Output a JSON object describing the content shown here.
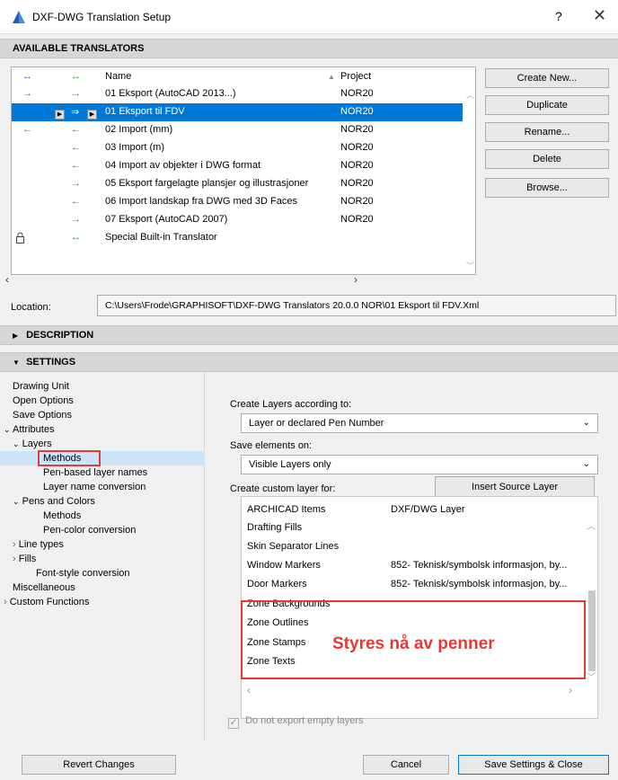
{
  "window": {
    "title": "DXF-DWG Translation Setup",
    "help_label": "?",
    "close_label": "✕"
  },
  "sections": {
    "available": "AVAILABLE TRANSLATORS",
    "description": "DESCRIPTION",
    "settings": "SETTINGS"
  },
  "translator_list": {
    "headers": {
      "name": "Name",
      "project": "Project"
    },
    "rows": [
      {
        "arrow_a": "→",
        "arrow_b": "→",
        "name": "01 Eksport (AutoCAD 2013...)",
        "project": "NOR20"
      },
      {
        "arrow_a": "",
        "arrow_b": "⇒",
        "name": "01 Eksport til FDV",
        "project": "NOR20"
      },
      {
        "arrow_a": "←",
        "arrow_b": "←",
        "name": "02 Import (mm)",
        "project": "NOR20"
      },
      {
        "arrow_a": "",
        "arrow_b": "←",
        "name": "03 Import (m)",
        "project": "NOR20"
      },
      {
        "arrow_a": "",
        "arrow_b": "←",
        "name": "04 Import av objekter i DWG format",
        "project": "NOR20"
      },
      {
        "arrow_a": "",
        "arrow_b": "→",
        "name": "05 Eksport fargelagte plansjer og illustrasjoner",
        "project": "NOR20"
      },
      {
        "arrow_a": "",
        "arrow_b": "←",
        "name": "06 Import landskap fra DWG med 3D Faces",
        "project": "NOR20"
      },
      {
        "arrow_a": "",
        "arrow_b": "→",
        "name": "07 Eksport (AutoCAD 2007)",
        "project": "NOR20"
      },
      {
        "arrow_a": "",
        "arrow_b": "↔",
        "name": "Special Built-in Translator",
        "project": ""
      }
    ]
  },
  "side_buttons": [
    "Create New...",
    "Duplicate",
    "Rename...",
    "Delete",
    "Browse..."
  ],
  "location": {
    "label": "Location:",
    "value": "C:\\Users\\Frode\\GRAPHISOFT\\DXF-DWG Translators 20.0.0 NOR\\01 Eksport til FDV.Xml"
  },
  "settings_tree": {
    "drawing_unit": "Drawing Unit",
    "open_options": "Open Options",
    "save_options": "Save Options",
    "attributes": "Attributes",
    "layers": "Layers",
    "methods": "Methods",
    "pen_based": "Pen-based layer names",
    "layer_name_conv": "Layer name conversion",
    "pens_colors": "Pens and Colors",
    "pens_methods": "Methods",
    "pen_color_conv": "Pen-color conversion",
    "line_types": "Line types",
    "fills": "Fills",
    "font_style": "Font-style conversion",
    "misc": "Miscellaneous",
    "custom_functions": "Custom Functions"
  },
  "panel": {
    "create_layers_label": "Create Layers according to:",
    "create_layers_value": "Layer or declared Pen Number",
    "save_elements_label": "Save elements on:",
    "save_elements_value": "Visible Layers only",
    "custom_layer_label": "Create custom layer for:",
    "insert_source_layer": "Insert Source Layer",
    "layer_rows": [
      {
        "item": "ARCHICAD Items",
        "layer": "DXF/DWG Layer"
      },
      {
        "item": "Drafting Fills",
        "layer": ""
      },
      {
        "item": "Skin Separator Lines",
        "layer": ""
      },
      {
        "item": "Window Markers",
        "layer": "852- Teknisk/symbolsk informasjon, by..."
      },
      {
        "item": "Door Markers",
        "layer": "852- Teknisk/symbolsk informasjon, by..."
      },
      {
        "item": "Zone Backgrounds",
        "layer": ""
      },
      {
        "item": "Zone Outlines",
        "layer": ""
      },
      {
        "item": "Zone Stamps",
        "layer": ""
      },
      {
        "item": "Zone Texts",
        "layer": ""
      }
    ],
    "annotation": "Styres nå av penner",
    "checkbox_label": "Do not export empty layers",
    "checkbox_mark": "✓"
  },
  "footer": {
    "revert": "Revert Changes",
    "cancel": "Cancel",
    "save_close": "Save Settings & Close"
  },
  "colors": {
    "accent": "#0078d7",
    "annotation_red": "#e53935"
  }
}
